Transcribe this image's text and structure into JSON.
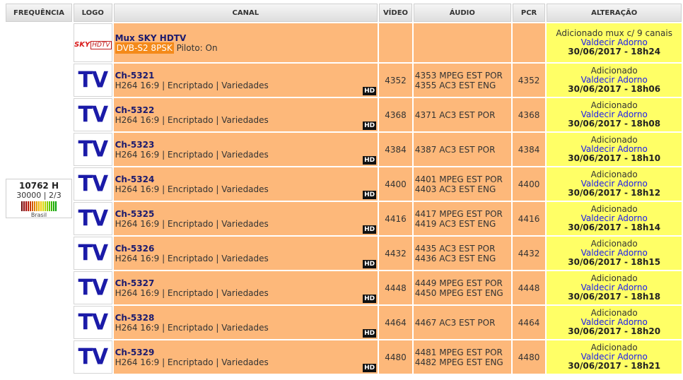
{
  "headers": {
    "frequency": "FREQUÊNCIA",
    "logo": "LOGO",
    "channel": "CANAL",
    "video": "VÍDEO",
    "audio": "ÁUDIO",
    "pcr": "PCR",
    "change": "ALTERAÇÃO"
  },
  "frequency": {
    "value": "10762 H",
    "symbolrate_fec": "30000 | 2/3",
    "country": "Brasil",
    "signal_colors": [
      "#6b0000",
      "#8a0000",
      "#a30000",
      "#b81a00",
      "#c83a00",
      "#d35a00",
      "#de7a00",
      "#e69a00",
      "#eeb400",
      "#f2c800",
      "#d8d800",
      "#b4d200",
      "#8ccc00",
      "#5ec400",
      "#36b800",
      "#1aaa00",
      "#00a000"
    ]
  },
  "mux": {
    "logo": "sky-hdtv-logo",
    "logo_text": "SKY",
    "logo_hd": "HDTV",
    "name": "Mux SKY HDTV",
    "system": "DVB-S2 8PSK",
    "pilot": "Piloto: On",
    "change": {
      "status": "Adicionado mux c/ 9 canais",
      "user": "Valdecir Adorno",
      "date": "30/06/2017 - 18h24"
    }
  },
  "channels": [
    {
      "logo": "TV",
      "name": "Ch-5321",
      "desc": "H264 16:9 | Encriptado | Variedades",
      "badge": "HD",
      "video": "4352",
      "audio": [
        "4353 MPEG EST POR",
        "4355 AC3 EST ENG"
      ],
      "pcr": "4352",
      "status": "Adicionado",
      "user": "Valdecir Adorno",
      "date": "30/06/2017 - 18h06"
    },
    {
      "logo": "TV",
      "name": "Ch-5322",
      "desc": "H264 16:9 | Encriptado | Variedades",
      "badge": "HD",
      "video": "4368",
      "audio": [
        "4371 AC3 EST POR"
      ],
      "pcr": "4368",
      "status": "Adicionado",
      "user": "Valdecir Adorno",
      "date": "30/06/2017 - 18h08"
    },
    {
      "logo": "TV",
      "name": "Ch-5323",
      "desc": "H264 16:9 | Encriptado | Variedades",
      "badge": "HD",
      "video": "4384",
      "audio": [
        "4387 AC3 EST POR"
      ],
      "pcr": "4384",
      "status": "Adicionado",
      "user": "Valdecir Adorno",
      "date": "30/06/2017 - 18h10"
    },
    {
      "logo": "TV",
      "name": "Ch-5324",
      "desc": "H264 16:9 | Encriptado | Variedades",
      "badge": "HD",
      "video": "4400",
      "audio": [
        "4401 MPEG EST POR",
        "4403 AC3 EST ENG"
      ],
      "pcr": "4400",
      "status": "Adicionado",
      "user": "Valdecir Adorno",
      "date": "30/06/2017 - 18h12"
    },
    {
      "logo": "TV",
      "name": "Ch-5325",
      "desc": "H264 16:9 | Encriptado | Variedades",
      "badge": "HD",
      "video": "4416",
      "audio": [
        "4417 MPEG EST POR",
        "4419 AC3 EST ENG"
      ],
      "pcr": "4416",
      "status": "Adicionado",
      "user": "Valdecir Adorno",
      "date": "30/06/2017 - 18h14"
    },
    {
      "logo": "TV",
      "name": "Ch-5326",
      "desc": "H264 16:9 | Encriptado | Variedades",
      "badge": "HD",
      "video": "4432",
      "audio": [
        "4435 AC3 EST POR",
        "4436 AC3 EST ENG"
      ],
      "pcr": "4432",
      "status": "Adicionado",
      "user": "Valdecir Adorno",
      "date": "30/06/2017 - 18h15"
    },
    {
      "logo": "TV",
      "name": "Ch-5327",
      "desc": "H264 16:9 | Encriptado | Variedades",
      "badge": "HD",
      "video": "4448",
      "audio": [
        "4449 MPEG EST POR",
        "4450 MPEG EST ENG"
      ],
      "pcr": "4448",
      "status": "Adicionado",
      "user": "Valdecir Adorno",
      "date": "30/06/2017 - 18h18"
    },
    {
      "logo": "TV",
      "name": "Ch-5328",
      "desc": "H264 16:9 | Encriptado | Variedades",
      "badge": "HD",
      "video": "4464",
      "audio": [
        "4467 AC3 EST POR"
      ],
      "pcr": "4464",
      "status": "Adicionado",
      "user": "Valdecir Adorno",
      "date": "30/06/2017 - 18h20"
    },
    {
      "logo": "TV",
      "name": "Ch-5329",
      "desc": "H264 16:9 | Encriptado | Variedades",
      "badge": "HD",
      "video": "4480",
      "audio": [
        "4481 MPEG EST POR",
        "4482 MPEG EST ENG"
      ],
      "pcr": "4480",
      "status": "Adicionado",
      "user": "Valdecir Adorno",
      "date": "30/06/2017 - 18h21"
    }
  ]
}
